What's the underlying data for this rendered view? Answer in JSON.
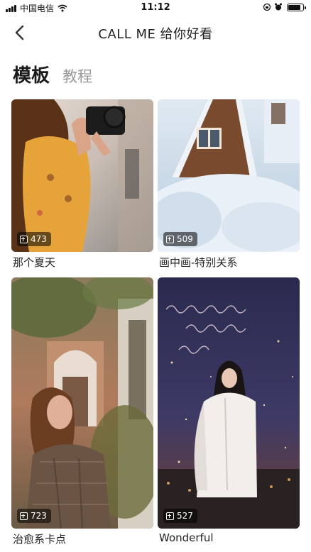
{
  "status_bar": {
    "carrier": "中国电信",
    "time": "11:12",
    "battery_level": 0.85
  },
  "nav": {
    "back_icon": "chevron-left-icon",
    "title": "CALL ME 给你好看"
  },
  "tabs": [
    {
      "label": "模板",
      "active": true
    },
    {
      "label": "教程",
      "active": false
    }
  ],
  "templates": [
    {
      "title": "那个夏天",
      "count": "473",
      "image": "woman-with-camera-photo"
    },
    {
      "title": "画中画-特别关系",
      "count": "509",
      "image": "snowy-cabin-photo"
    },
    {
      "title": "治愈系卡点",
      "count": "723",
      "image": "woman-in-garden-photo"
    },
    {
      "title": "Wonderful",
      "count": "527",
      "image": "woman-night-sky-photo"
    }
  ]
}
